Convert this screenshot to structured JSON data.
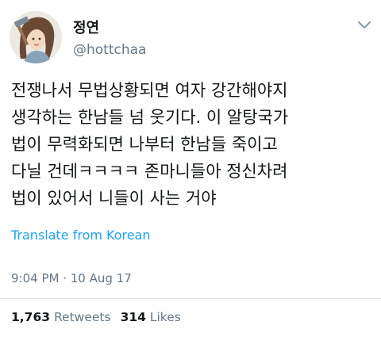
{
  "tweet": {
    "author_name": "정연",
    "author_handle": "@hottchaa",
    "text_lines": [
      "전쟁나서 무법상황되면 여자 강간해야지",
      "생각하는 한남들 넘 웃기다. 이 알탕국가",
      "법이 무력화되면 나부터 한남들 죽이고",
      "다닐 건데ㅋㅋㅋㅋ 존마니들아 정신차려",
      "법이 있어서 니들이 사는 거야"
    ],
    "translate_label": "Translate from Korean",
    "timestamp": "9:04 PM · 10 Aug 17",
    "retweets_count": "1,763",
    "retweets_label": "Retweets",
    "likes_count": "314",
    "likes_label": "Likes"
  },
  "icons": {
    "avatar": "profile-photo",
    "menu": "chevron-down-icon"
  },
  "colors": {
    "link": "#1da1f2",
    "secondary_text": "#657786",
    "primary_text": "#14171a"
  }
}
